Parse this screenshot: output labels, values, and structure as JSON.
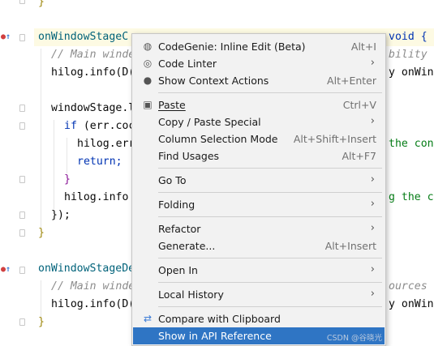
{
  "code": {
    "line0": "}",
    "line1_fn": "onWindowStageC",
    "line1_tail": "void {",
    "line2_comment": "// Main winde",
    "line2_tail": "bility",
    "line3": "hilog.info(D(",
    "line3_tail": "y onWind",
    "line5": "windowStage.l",
    "line6_kw": "if",
    "line6_rest": " (err.coc",
    "line7": "hilog.err",
    "line7_tail": "the cont",
    "line8_kw": "return;",
    "line9": "}",
    "line10": "hilog.info",
    "line10_tail": "g the c",
    "line11": "});",
    "line12": "}",
    "line14_fn": "onWindowStageDe",
    "line15_comment": "// Main winde",
    "line15_tail": "ources",
    "line16": "hilog.info(D(",
    "line16_tail": "y onWind",
    "line17": "}"
  },
  "gutter_icons": [
    "override-icon",
    "override-icon"
  ],
  "context_menu": {
    "items": [
      {
        "label": "CodeGenie: Inline Edit (Beta)",
        "shortcut": "Alt+I",
        "icon": "codegenie-icon"
      },
      {
        "label": "Code Linter",
        "submenu": true,
        "icon": "linter-icon"
      },
      {
        "label": "Show Context Actions",
        "shortcut": "Alt+Enter",
        "icon": "bulb-icon"
      },
      {
        "label": "Paste",
        "shortcut": "Ctrl+V",
        "icon": "paste-icon"
      },
      {
        "label": "Copy / Paste Special",
        "submenu": true
      },
      {
        "label": "Column Selection Mode",
        "shortcut": "Alt+Shift+Insert"
      },
      {
        "label": "Find Usages",
        "shortcut": "Alt+F7"
      },
      {
        "label": "Go To",
        "submenu": true
      },
      {
        "label": "Folding",
        "submenu": true
      },
      {
        "label": "Refactor",
        "submenu": true
      },
      {
        "label": "Generate...",
        "shortcut": "Alt+Insert"
      },
      {
        "label": "Open In",
        "submenu": true
      },
      {
        "label": "Local History",
        "submenu": true
      },
      {
        "label": "Compare with Clipboard",
        "icon": "compare-icon"
      },
      {
        "label": "Show in API Reference",
        "selected": true
      }
    ],
    "watermark": "CSDN @谷晓光"
  },
  "colors": {
    "selection": "#2f75c4",
    "menu_bg": "#f2f2f2",
    "line_highlight": "#fdfae3"
  }
}
